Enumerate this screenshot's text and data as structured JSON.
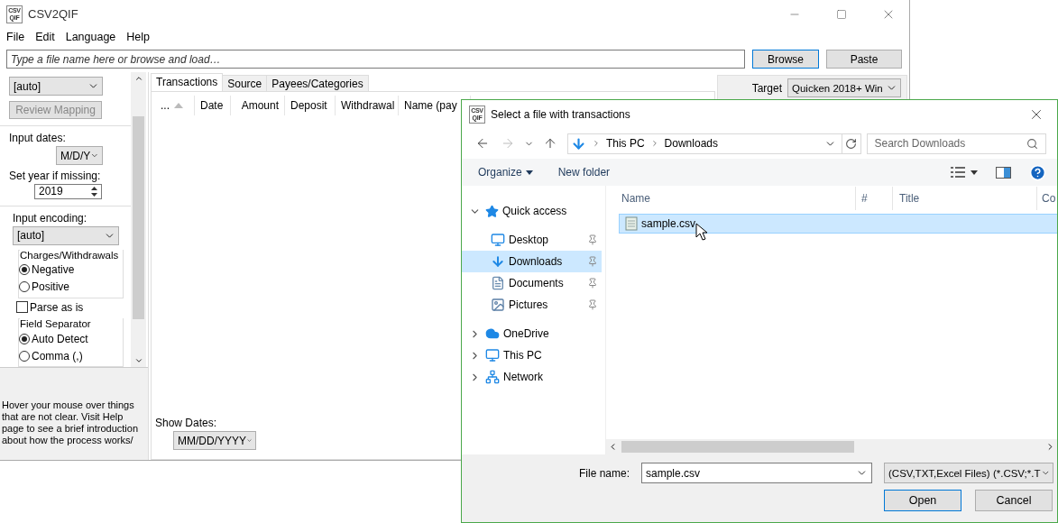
{
  "main_window": {
    "logo": [
      "CSV",
      "QIF"
    ],
    "title": "CSV2QIF",
    "menu": [
      "File",
      "Edit",
      "Language",
      "Help"
    ],
    "file_field": {
      "placeholder": "Type a file name here or browse and load…"
    },
    "buttons": [
      "Browse",
      "Paste"
    ],
    "sidebar": {
      "mapping_select": "[auto]",
      "review_button": {
        "label": "Review Mapping",
        "disabled": true
      },
      "input_dates_label": "Input dates:",
      "input_dates_value": "M/D/Y",
      "year_label": "Set year if missing:",
      "year_value": "2019",
      "encoding_label": "Input encoding:",
      "encoding_value": "[auto]",
      "charges_group": {
        "title": "Charges/Withdrawals",
        "options": [
          {
            "label": "Negative",
            "selected": true
          },
          {
            "label": "Positive",
            "selected": false
          }
        ]
      },
      "parse_as_is": {
        "label": "Parse as is",
        "checked": false
      },
      "separator_group": {
        "title": "Field Separator",
        "options": [
          {
            "label": "Auto Detect",
            "selected": true
          },
          {
            "label": "Comma (,)",
            "selected": false
          }
        ]
      }
    },
    "help_text": "Hover your mouse over things that are not clear. Visit Help page to see a brief introduction about how the process works/",
    "tabs": [
      {
        "label": "Transactions",
        "selected": true
      },
      {
        "label": "Source",
        "selected": false
      },
      {
        "label": "Payees/Categories",
        "selected": false
      }
    ],
    "columns": [
      "...",
      "Date",
      "Amount",
      "Deposit",
      "Withdrawal",
      "Name (pay"
    ],
    "show_dates_label": "Show Dates:",
    "show_dates_value": "MM/DD/YYYY",
    "target_label": "Target",
    "target_value": "Quicken 2018+ Win"
  },
  "dialog": {
    "logo": [
      "CSV",
      "QIF"
    ],
    "title": "Select a file with transactions",
    "breadcrumb": [
      "This PC",
      "Downloads"
    ],
    "search": {
      "placeholder": "Search Downloads"
    },
    "toolbar": [
      "Organize",
      "New folder"
    ],
    "nav": [
      {
        "label": "Quick access",
        "expanded": true,
        "selected": false,
        "children": [
          {
            "label": "Desktop",
            "selected": false
          },
          {
            "label": "Downloads",
            "selected": true
          },
          {
            "label": "Documents",
            "selected": false
          },
          {
            "label": "Pictures",
            "selected": false
          }
        ]
      },
      {
        "label": "OneDrive",
        "expanded": false,
        "selected": false
      },
      {
        "label": "This PC",
        "expanded": false,
        "selected": false
      },
      {
        "label": "Network",
        "expanded": false,
        "selected": false
      }
    ],
    "columns": [
      "Name",
      "#",
      "Title",
      "Co"
    ],
    "files": [
      {
        "name": "sample.csv",
        "selected": true
      }
    ],
    "file_name_label": "File name:",
    "file_name_value": "sample.csv",
    "file_type": "(CSV,TXT,Excel Files) (*.CSV;*.T",
    "buttons": [
      "Open",
      "Cancel"
    ]
  }
}
